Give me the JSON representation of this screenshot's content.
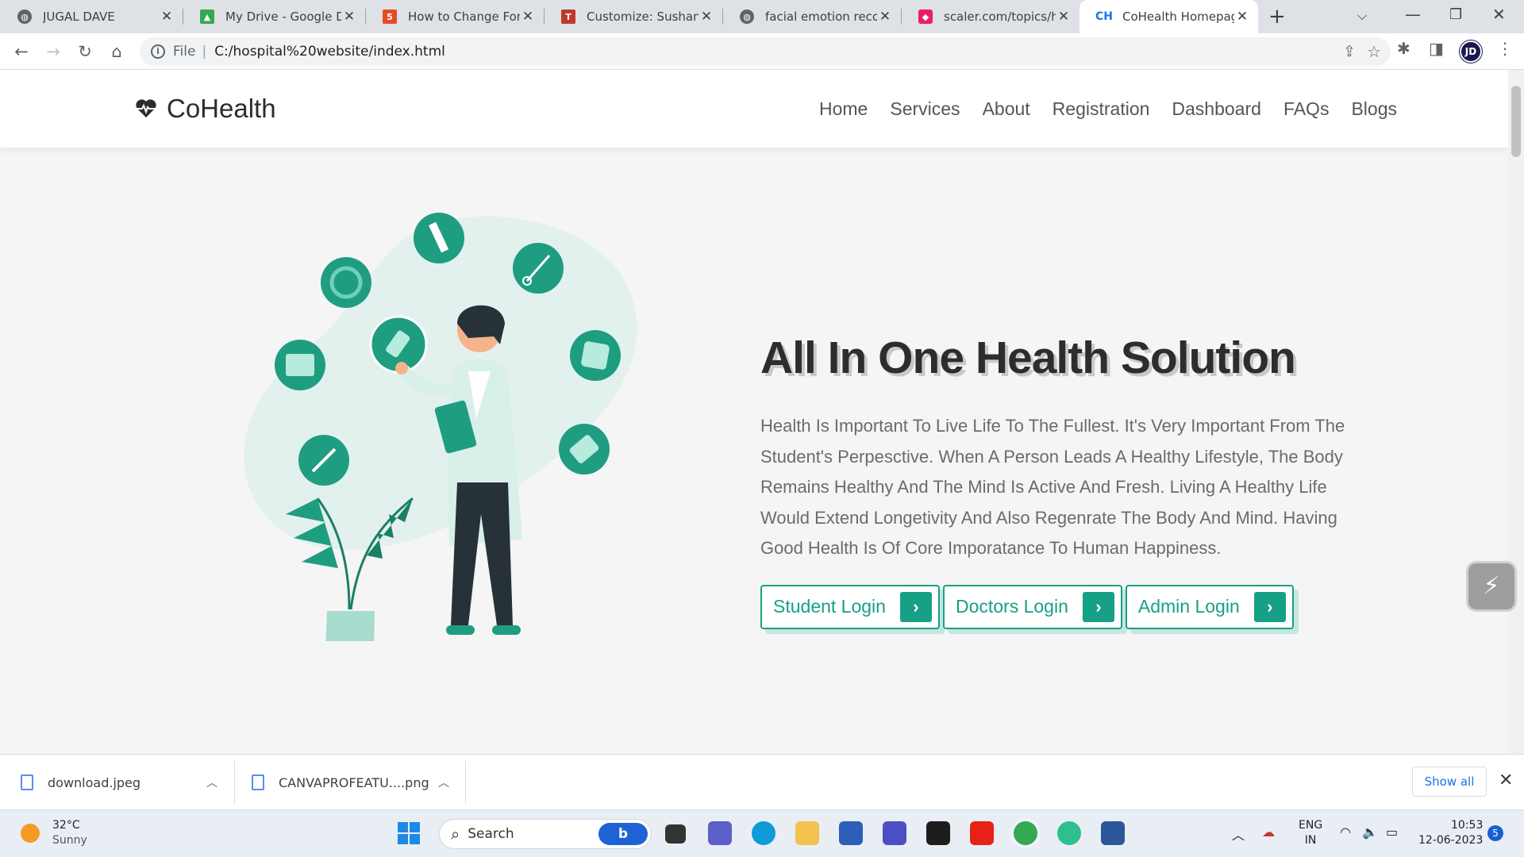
{
  "browser": {
    "tabs": [
      {
        "title": "JUGAL DAVE",
        "favicon": "globe-icon",
        "color": "#5f6368"
      },
      {
        "title": "My Drive - Google Dri",
        "favicon": "google-drive-icon",
        "color": "#34a853"
      },
      {
        "title": "How to Change Font",
        "favicon": "html5-icon",
        "color": "#e44d26"
      },
      {
        "title": "Customize: Sushant Sl",
        "favicon": "tm-icon",
        "color": "#c0392b"
      },
      {
        "title": "facial emotion recogn",
        "favicon": "globe-icon",
        "color": "#5f6368"
      },
      {
        "title": "scaler.com/topics/ho",
        "favicon": "scaler-icon",
        "color": "#e91e63"
      },
      {
        "title": "CoHealth Homepage",
        "favicon": "ch-logo-icon",
        "color": "#1a73e8"
      }
    ],
    "active_tab_index": 6,
    "address": {
      "scheme": "File",
      "url": "C:/hospital%20website/index.html"
    }
  },
  "site": {
    "brand": "CoHealth",
    "nav": [
      "Home",
      "Services",
      "About",
      "Registration",
      "Dashboard",
      "FAQs",
      "Blogs"
    ],
    "hero": {
      "title": "All In One Health Solution",
      "description": "Health Is Important To Live Life To The Fullest. It's Very Important From The Student's Perpesctive. When A Person Leads A Healthy Lifestyle, The Body Remains Healthy And The Mind Is Active And Fresh. Living A Healthy Life Would Extend Longetivity And Also Regenrate The Body And Mind. Having Good Health Is Of Core Imporatance To Human Happiness.",
      "buttons": [
        {
          "label": "Student Login"
        },
        {
          "label": "Doctors Login"
        },
        {
          "label": "Admin Login"
        }
      ]
    },
    "colors": {
      "accent": "#16a085",
      "accent_light": "#c6e7de"
    }
  },
  "downloads": {
    "items": [
      {
        "name": "download.jpeg"
      },
      {
        "name": "CANVAPROFEATU....png"
      }
    ],
    "show_all": "Show all"
  },
  "taskbar": {
    "weather": {
      "temp": "32°C",
      "condition": "Sunny"
    },
    "search_label": "Search",
    "lang": {
      "line1": "ENG",
      "line2": "IN"
    },
    "time": "10:53",
    "date": "12-06-2023",
    "notification_count": "5"
  }
}
